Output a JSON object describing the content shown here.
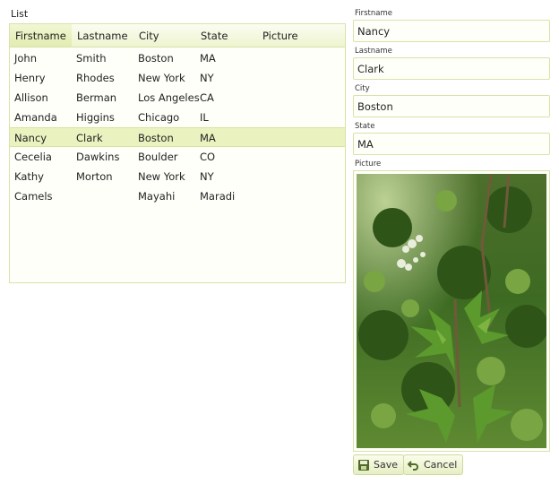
{
  "list": {
    "title": "List",
    "columns": [
      "Firstname",
      "Lastname",
      "City",
      "State",
      "Picture"
    ],
    "rows": [
      [
        "John",
        "Smith",
        "Boston",
        "MA",
        ""
      ],
      [
        "Henry",
        "Rhodes",
        "New York",
        "NY",
        ""
      ],
      [
        "Allison",
        "Berman",
        "Los Angeles",
        "CA",
        ""
      ],
      [
        "Amanda",
        "Higgins",
        "Chicago",
        "IL",
        ""
      ],
      [
        "Nancy",
        "Clark",
        "Boston",
        "MA",
        ""
      ],
      [
        "Cecelia",
        "Dawkins",
        "Boulder",
        "CO",
        ""
      ],
      [
        "Kathy",
        "Morton",
        "New York",
        "NY",
        ""
      ],
      [
        "Camels",
        "",
        "Mayahi",
        "Maradi",
        ""
      ]
    ],
    "selected_row": 4,
    "sorted_column": 0
  },
  "form": {
    "firstname_label": "Firstname",
    "firstname_value": "Nancy",
    "lastname_label": "Lastname",
    "lastname_value": "Clark",
    "city_label": "City",
    "city_value": "Boston",
    "state_label": "State",
    "state_value": "MA",
    "picture_label": "Picture",
    "picture_icon": "plant-photo"
  },
  "buttons": {
    "save_label": "Save",
    "save_icon": "floppy-disk-icon",
    "cancel_label": "Cancel",
    "cancel_icon": "undo-arrow-icon"
  },
  "colors": {
    "accent": "#d9e2a8",
    "selected_row": "#eaf3c0",
    "header": "#eef4cf"
  }
}
